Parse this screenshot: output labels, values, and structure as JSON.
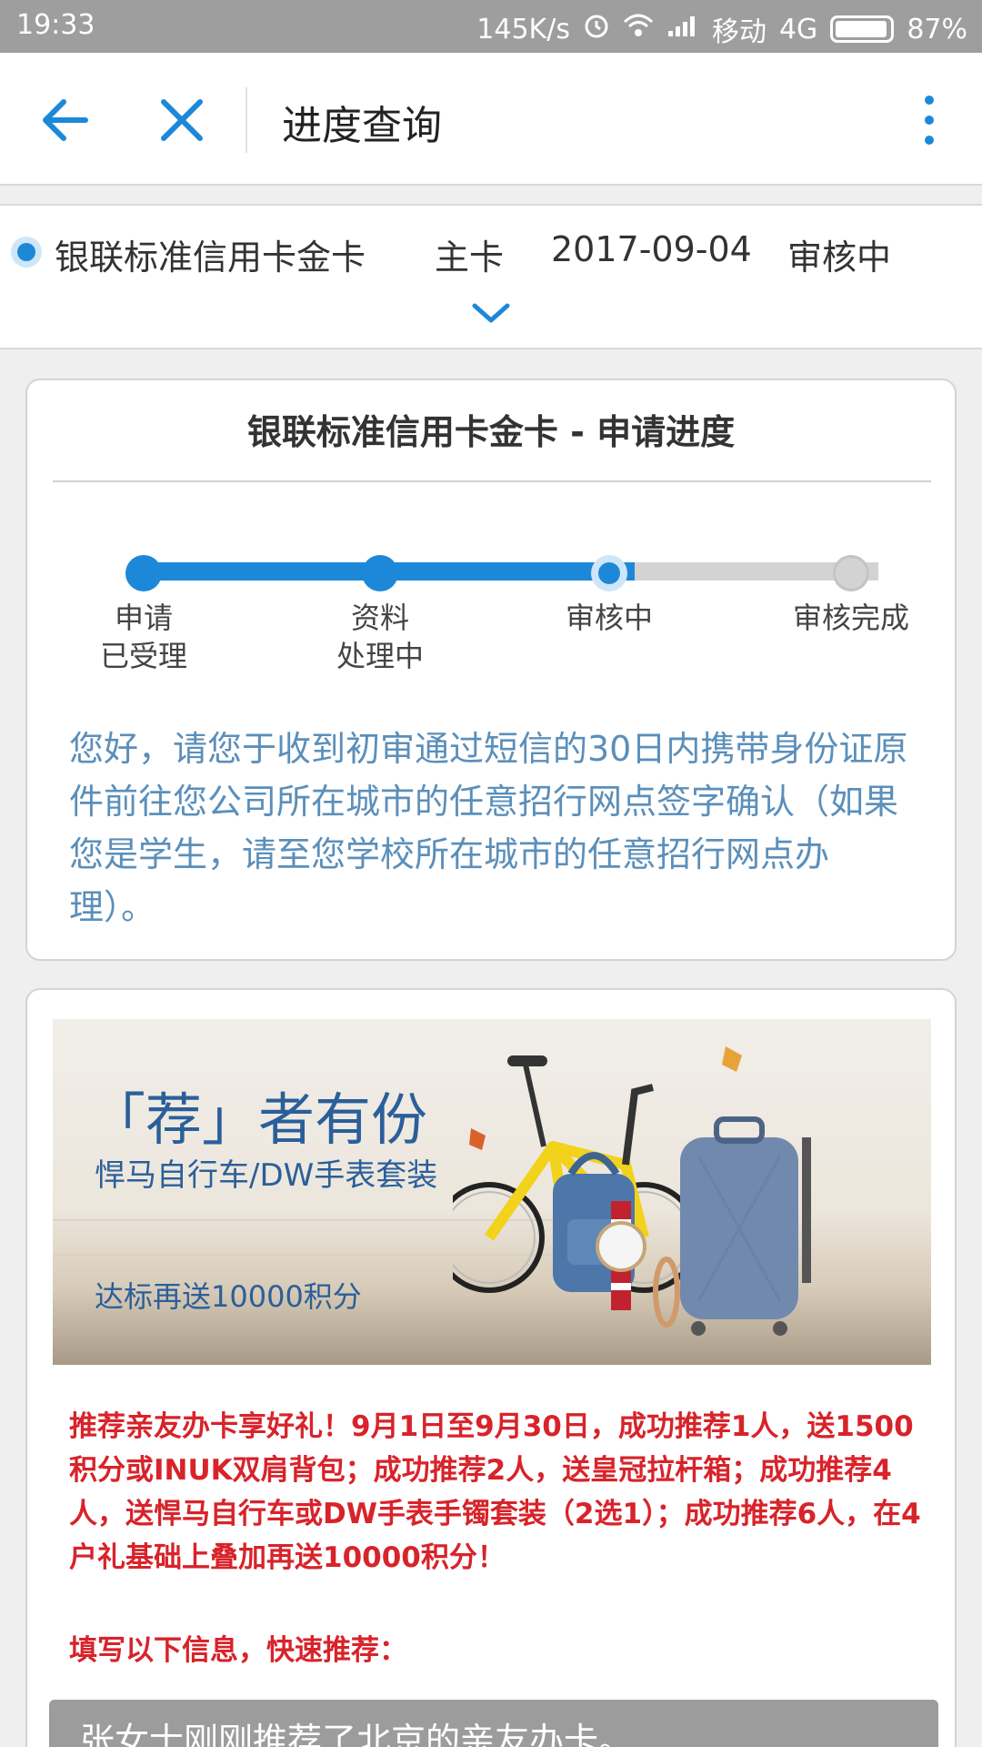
{
  "status_bar": {
    "time": "19:33",
    "speed": "145K/s",
    "carrier": "移动",
    "network": "4G",
    "battery": "87%"
  },
  "nav": {
    "title": "进度查询"
  },
  "card_selector": {
    "card_name": "银联标准信用卡金卡",
    "card_type": "主卡",
    "date": "2017-09-04",
    "status": "审核中"
  },
  "progress": {
    "title": "银联标准信用卡金卡 - 申请进度",
    "steps": [
      {
        "line1": "申请",
        "line2": "已受理",
        "state": "done"
      },
      {
        "line1": "资料",
        "line2": "处理中",
        "state": "done"
      },
      {
        "line1": "审核中",
        "line2": "",
        "state": "current"
      },
      {
        "line1": "审核完成",
        "line2": "",
        "state": "todo"
      }
    ],
    "notice": "您好，请您于收到初审通过短信的30日内携带身份证原件前往您公司所在城市的任意招行网点签字确认（如果您是学生，请至您学校所在城市的任意招行网点办理）。"
  },
  "promo": {
    "banner_headline": "「荐」者有份",
    "banner_subline": "悍马自行车/DW手表套装",
    "banner_bonus": "达标再送10000积分",
    "text": "推荐亲友办卡享好礼！9月1日至9月30日，成功推荐1人，送1500积分或INUK双肩背包；成功推荐2人，送皇冠拉杆箱；成功推荐4人，送悍马自行车或DW手表手镯套装（2选1）；成功推荐6人，在4户礼基础上叠加再送10000积分！",
    "cta": "填写以下信息，快速推荐：",
    "ticker": "张女士刚刚推荐了北京的亲友办卡。"
  },
  "colors": {
    "accent": "#1e88d8",
    "notice_text": "#5b8fba",
    "promo_text": "#d8232a",
    "status_bar": "#9e9e9e"
  }
}
